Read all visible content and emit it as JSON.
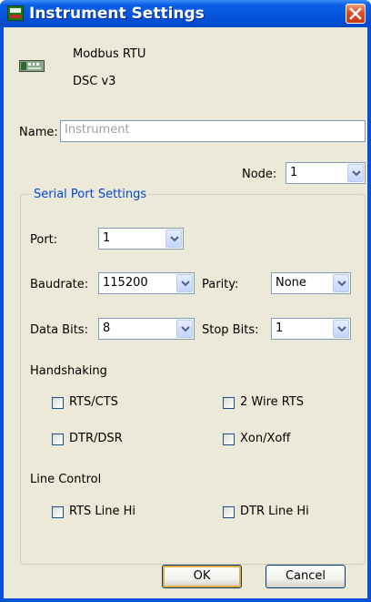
{
  "window": {
    "title": "Instrument Settings"
  },
  "device": {
    "protocol": "Modbus RTU",
    "model": "DSC v3",
    "icon": "device-icon"
  },
  "name_field": {
    "label": "Name:",
    "placeholder": "Instrument"
  },
  "node": {
    "label": "Node:",
    "value": "1"
  },
  "serial": {
    "title": "Serial Port Settings",
    "port": {
      "label": "Port:",
      "value": "1"
    },
    "baudrate": {
      "label": "Baudrate:",
      "value": "115200"
    },
    "parity": {
      "label": "Parity:",
      "value": "None"
    },
    "data_bits": {
      "label": "Data Bits:",
      "value": "8"
    },
    "stop_bits": {
      "label": "Stop Bits:",
      "value": "1"
    },
    "handshaking": {
      "title": "Handshaking",
      "rts_cts": "RTS/CTS",
      "two_wire_rts": "2 Wire RTS",
      "dtr_dsr": "DTR/DSR",
      "xon_xoff": "Xon/Xoff"
    },
    "line_control": {
      "title": "Line Control",
      "rts_line_hi": "RTS Line Hi",
      "dtr_line_hi": "DTR Line Hi"
    }
  },
  "buttons": {
    "ok": "OK",
    "cancel": "Cancel"
  }
}
